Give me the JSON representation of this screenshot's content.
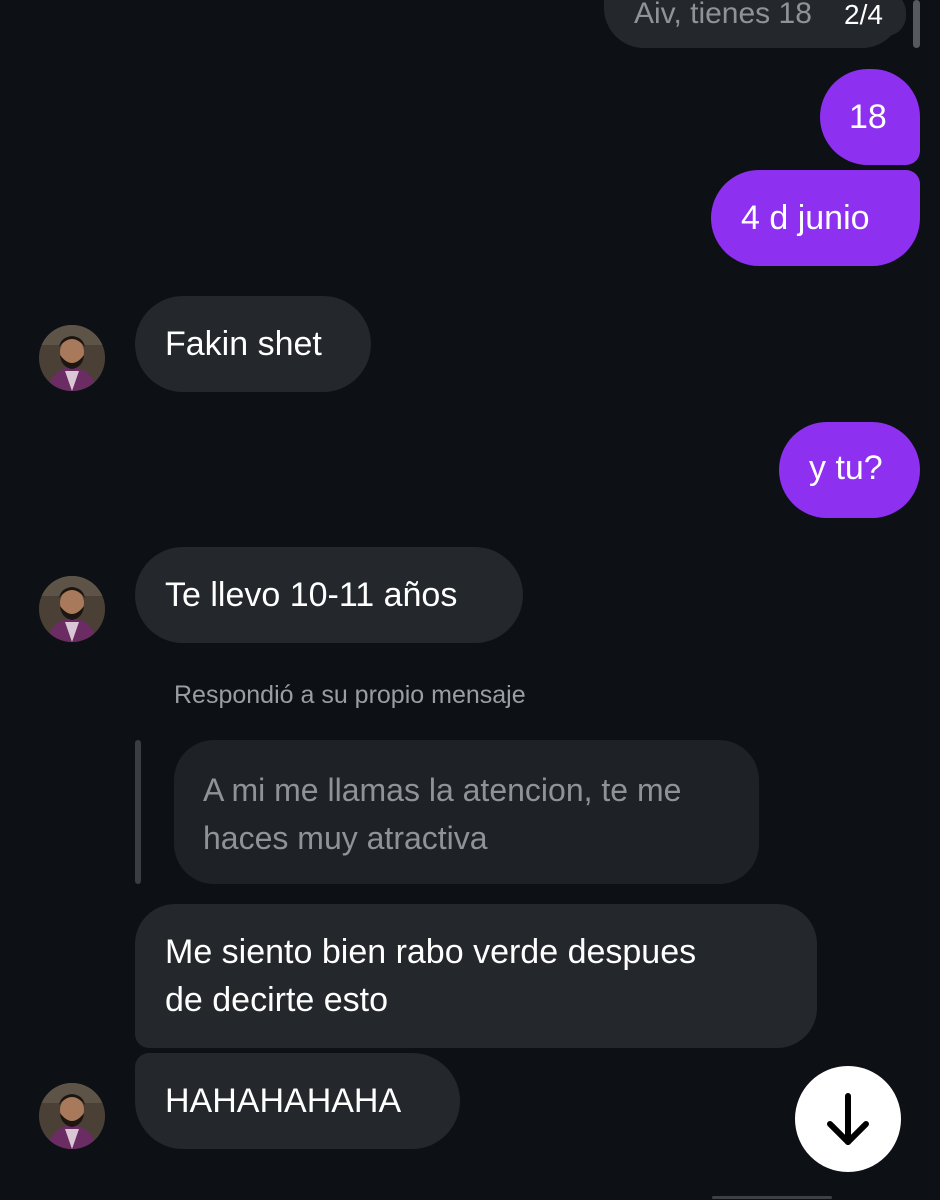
{
  "thread": {
    "top_partial_message": "Aiv, tienes 18",
    "media_counter": "2/4"
  },
  "messages": {
    "out_age": "18",
    "out_birthday": "4 d junio",
    "in_fakin": "Fakin shet",
    "out_ytu": "y tu?",
    "in_te_llevo": "Te llevo 10-11 años",
    "reply_note": "Respondió a su propio mensaje",
    "quoted_reply_line1": "A mi me llamas la atencion, te me",
    "quoted_reply_line2": "haces muy atractiva",
    "in_rabo_line1": "Me siento bien rabo verde despues",
    "in_rabo_line2": "de decirte esto",
    "in_haha": "HAHAHAHAHA"
  },
  "controls": {
    "scroll_down_icon": "arrow-down-icon"
  },
  "colors": {
    "background": "#0d1115",
    "incoming_bubble": "#24272b",
    "outgoing_bubble": "#8d30f0",
    "quoted_text": "#8f9398",
    "meta_text": "#9a9ea3"
  }
}
